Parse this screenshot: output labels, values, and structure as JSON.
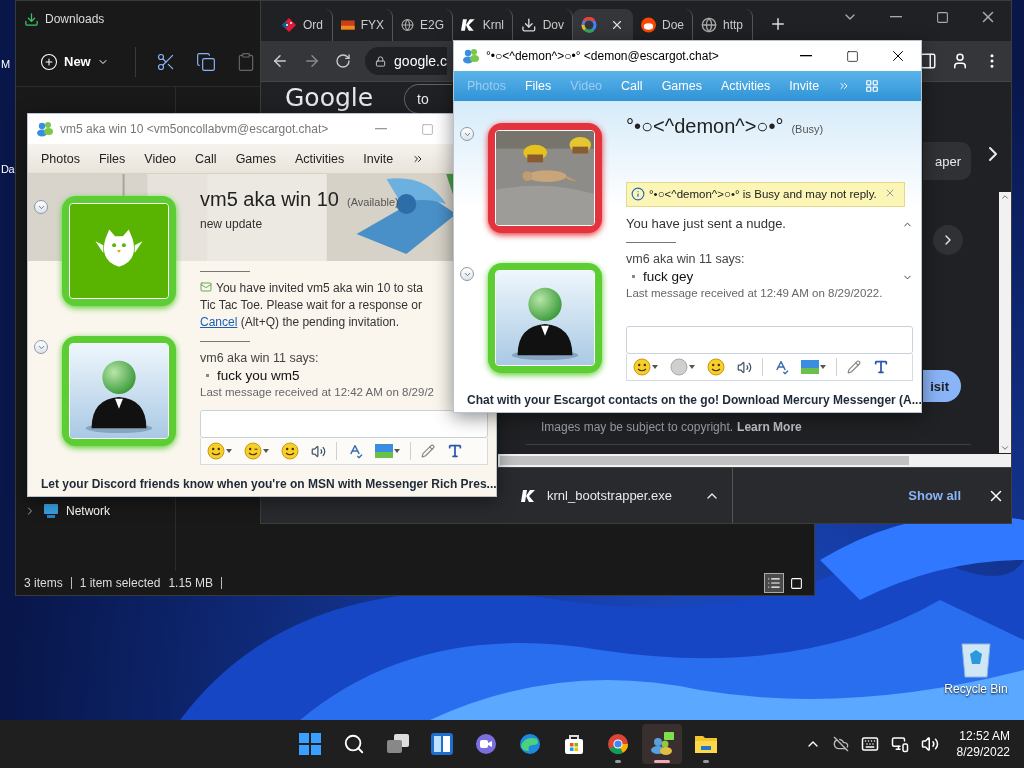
{
  "desktop": {
    "edge_labels": [
      "M",
      "Da"
    ],
    "recycle_bin_label": "Recycle Bin"
  },
  "explorer": {
    "title": "Downloads",
    "new_label": "New",
    "nav_items": [
      {
        "label": "Network"
      }
    ],
    "status_count": "3 items",
    "status_selection": "1 item selected",
    "status_size": "1.15 MB",
    "views": [
      {
        "kind": "details",
        "selected": true
      },
      {
        "kind": "large",
        "selected": false
      }
    ]
  },
  "browser": {
    "tabs": [
      {
        "label": "Ord",
        "selected": false
      },
      {
        "label": "FYX",
        "selected": false
      },
      {
        "label": "E2G",
        "selected": false
      },
      {
        "label": "Krnl",
        "selected": false
      },
      {
        "label": "Dov",
        "selected": false
      },
      {
        "selected": true
      },
      {
        "label": "Doe",
        "selected": false
      },
      {
        "label": "http",
        "selected": false
      }
    ],
    "address": "google.c",
    "logo": "Google",
    "search_value": "to",
    "chip": "aper",
    "visit_button": "isit",
    "copyright_note": "Images may be subject to copyright.",
    "learn_more": "Learn More",
    "download_file": "krnl_bootstrapper.exe",
    "show_all": "Show all"
  },
  "chats": [
    {
      "kind": "graffiti",
      "active": false,
      "title": "vm5 aka win 10 <vm5oncollabvm@escargot.chat>",
      "controls": [
        {
          "kind": "minimize"
        },
        {
          "kind": "maximize"
        }
      ],
      "overflow_menu": false,
      "menu": [
        {
          "label": "Photos",
          "disabled": false
        },
        {
          "label": "Files",
          "disabled": false
        },
        {
          "label": "Video",
          "disabled": false
        },
        {
          "label": "Call",
          "disabled": false
        },
        {
          "label": "Games",
          "disabled": false
        },
        {
          "label": "Activities",
          "disabled": false
        },
        {
          "label": "Invite",
          "disabled": false
        }
      ],
      "contact": {
        "name": "vm5 aka win 10",
        "status": "(Available)",
        "busy": false,
        "message": "new update",
        "kind": "owl"
      },
      "own": {
        "busy": false,
        "kind": "default"
      },
      "events": [
        {
          "kind": "invite",
          "lines": [
            "You have invited vm5 aka win 10 to sta",
            "Tic Tac Toe. Please wait for a response or"
          ],
          "link": "Cancel",
          "tail": "(Alt+Q) the pending invitation."
        },
        {
          "kind": "message",
          "sender": "vm6 aka win 11 says:",
          "items": [
            "fuck you wm5"
          ]
        }
      ],
      "last_received": "Last message received at 12:42 AM on 8/29/2",
      "wink_disabled": false,
      "footer": "Let your Discord friends know when you're on MSN with Messenger Rich Pres..."
    },
    {
      "kind": "sky",
      "active": true,
      "title": "°•○<^demon^>○•° <demon@escargot.chat>",
      "controls": [
        {
          "kind": "minimize"
        },
        {
          "kind": "maximize"
        },
        {
          "kind": "close"
        }
      ],
      "overflow_menu": true,
      "menu": [
        {
          "label": "Photos",
          "disabled": true
        },
        {
          "label": "Files",
          "disabled": false
        },
        {
          "label": "Video",
          "disabled": true
        },
        {
          "label": "Call",
          "disabled": false
        },
        {
          "label": "Games",
          "disabled": false
        },
        {
          "label": "Activities",
          "disabled": false
        },
        {
          "label": "Invite",
          "disabled": false
        }
      ],
      "contact": {
        "name": "°•○<^demon^>○•°",
        "status": "(Busy)",
        "busy": true
      },
      "own": {
        "busy": false,
        "kind": "default"
      },
      "notice": "°•○<^demon^>○•° is Busy and may not reply.",
      "events": [
        {
          "kind": "system",
          "text": "You have just sent a nudge."
        },
        {
          "kind": "message",
          "sender": "vm6 aka win 11 says:",
          "items": [
            "fuck gey"
          ]
        }
      ],
      "last_received": "Last message received at 12:49 AM on 8/29/2022.",
      "wink_disabled": true,
      "scrollbar": true,
      "footer": "Chat with your Escargot contacts on the go! Download Mercury Messenger (A..."
    }
  ],
  "taskbar": {
    "apps": [
      {
        "selected": false,
        "running": false
      },
      {
        "selected": false,
        "running": false
      },
      {
        "selected": false,
        "running": false
      },
      {
        "selected": false,
        "running": false
      },
      {
        "selected": false,
        "running": false
      },
      {
        "selected": false,
        "running": false
      },
      {
        "selected": false,
        "running": false
      },
      {
        "selected": false,
        "running": true
      },
      {
        "selected": true,
        "running": true
      },
      {
        "selected": false,
        "running": true
      }
    ],
    "time": "12:52 AM",
    "date": "8/29/2022"
  }
}
